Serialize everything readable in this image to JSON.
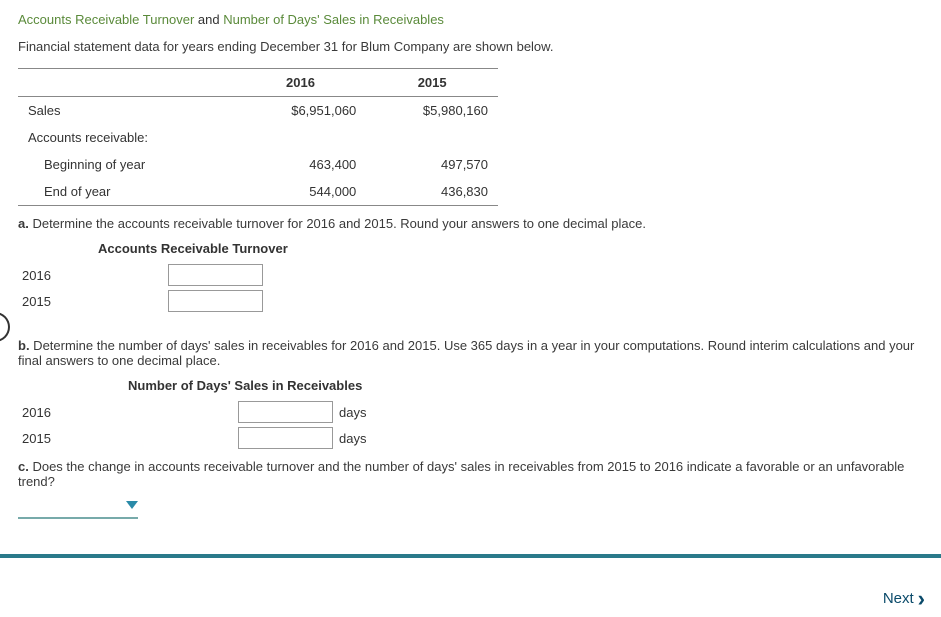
{
  "title": {
    "part1": "Accounts Receivable Turnover",
    "and": " and ",
    "part2": "Number of Days' Sales in Receivables"
  },
  "intro": "Financial statement data for years ending December 31 for Blum Company are shown below.",
  "table": {
    "years": {
      "y1": "2016",
      "y2": "2015"
    },
    "rows": {
      "sales_label": "Sales",
      "sales_y1": "$6,951,060",
      "sales_y2": "$5,980,160",
      "ar_label": "Accounts receivable:",
      "begin_label": "Beginning of year",
      "begin_y1": "463,400",
      "begin_y2": "497,570",
      "end_label": "End of year",
      "end_y1": "544,000",
      "end_y2": "436,830"
    }
  },
  "qa": {
    "letter": "a.",
    "text": "  Determine the accounts receivable turnover for 2016 and 2015. Round your answers to one decimal place.",
    "subhead": "Accounts Receivable Turnover",
    "y2016": "2016",
    "y2015": "2015"
  },
  "qb": {
    "letter": "b.",
    "text": "  Determine the number of days' sales in receivables for 2016 and 2015. Use 365 days in a year in your computations. Round interim calculations and your final answers to one decimal place.",
    "subhead": "Number of Days' Sales in Receivables",
    "y2016": "2016",
    "y2015": "2015",
    "unit": "days"
  },
  "qc": {
    "letter": "c.",
    "text": "  Does the change in accounts receivable turnover and the number of days' sales in receivables from 2015 to 2016 indicate a favorable or an unfavorable trend?"
  },
  "footer": {
    "next": "Next"
  }
}
